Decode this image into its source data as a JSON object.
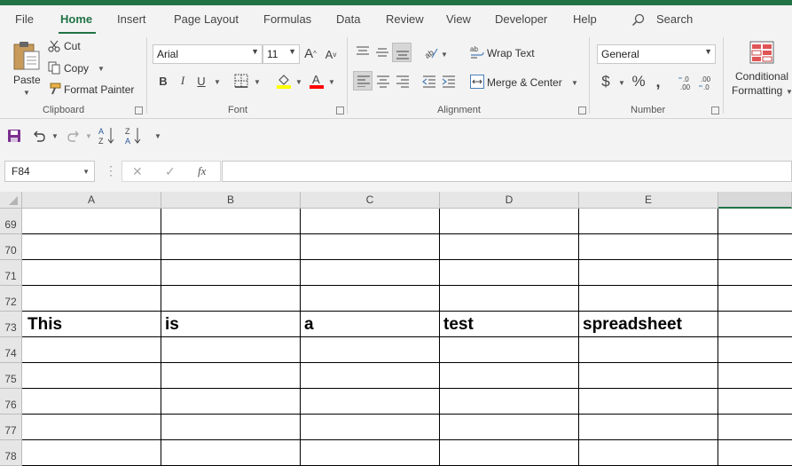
{
  "menu": {
    "tabs": [
      "File",
      "Home",
      "Insert",
      "Page Layout",
      "Formulas",
      "Data",
      "Review",
      "View",
      "Developer",
      "Help"
    ],
    "search_label": "Search"
  },
  "ribbon": {
    "clipboard": {
      "paste": "Paste",
      "cut": "Cut",
      "copy": "Copy",
      "format_painter": "Format Painter",
      "label": "Clipboard"
    },
    "font": {
      "family": "Arial",
      "size": "11",
      "label": "Font"
    },
    "alignment": {
      "wrap_text": "Wrap Text",
      "merge_center": "Merge & Center",
      "label": "Alignment"
    },
    "number": {
      "format": "General",
      "label": "Number"
    },
    "styles": {
      "conditional_line1": "Conditional",
      "conditional_line2": "Formatting"
    }
  },
  "formula_bar": {
    "name_box": "F84",
    "formula": ""
  },
  "sheet": {
    "columns": [
      "A",
      "B",
      "C",
      "D",
      "E"
    ],
    "rows": [
      {
        "num": "69",
        "cells": [
          "",
          "",
          "",
          "",
          ""
        ]
      },
      {
        "num": "70",
        "cells": [
          "",
          "",
          "",
          "",
          ""
        ]
      },
      {
        "num": "71",
        "cells": [
          "",
          "",
          "",
          "",
          ""
        ]
      },
      {
        "num": "72",
        "cells": [
          "",
          "",
          "",
          "",
          ""
        ]
      },
      {
        "num": "73",
        "cells": [
          "This",
          "is",
          "a",
          "test",
          "spreadsheet"
        ]
      },
      {
        "num": "74",
        "cells": [
          "",
          "",
          "",
          "",
          ""
        ]
      },
      {
        "num": "75",
        "cells": [
          "",
          "",
          "",
          "",
          ""
        ]
      },
      {
        "num": "76",
        "cells": [
          "",
          "",
          "",
          "",
          ""
        ]
      },
      {
        "num": "77",
        "cells": [
          "",
          "",
          "",
          "",
          ""
        ]
      },
      {
        "num": "78",
        "cells": [
          "",
          "",
          "",
          "",
          ""
        ]
      }
    ]
  },
  "colors": {
    "accent": "#217346",
    "font_highlight": "#ffff00",
    "font_color": "#ff0000"
  }
}
